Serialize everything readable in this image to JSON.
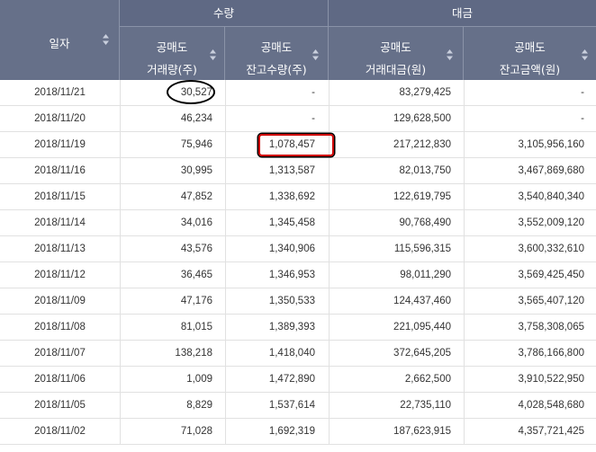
{
  "header": {
    "date_label": "일자",
    "group_quantity": "수량",
    "group_amount": "대금",
    "columns": [
      {
        "line1": "공매도",
        "line2": "거래량(주)"
      },
      {
        "line1": "공매도",
        "line2": "잔고수량(주)"
      },
      {
        "line1": "공매도",
        "line2": "거래대금(원)"
      },
      {
        "line1": "공매도",
        "line2": "잔고금액(원)"
      }
    ]
  },
  "rows": [
    [
      "2018/11/21",
      "30,527",
      "-",
      "83,279,425",
      "-"
    ],
    [
      "2018/11/20",
      "46,234",
      "-",
      "129,628,500",
      "-"
    ],
    [
      "2018/11/19",
      "75,946",
      "1,078,457",
      "217,212,830",
      "3,105,956,160"
    ],
    [
      "2018/11/16",
      "30,995",
      "1,313,587",
      "82,013,750",
      "3,467,869,680"
    ],
    [
      "2018/11/15",
      "47,852",
      "1,338,692",
      "122,619,795",
      "3,540,840,340"
    ],
    [
      "2018/11/14",
      "34,016",
      "1,345,458",
      "90,768,490",
      "3,552,009,120"
    ],
    [
      "2018/11/13",
      "43,576",
      "1,340,906",
      "115,596,315",
      "3,600,332,610"
    ],
    [
      "2018/11/12",
      "36,465",
      "1,346,953",
      "98,011,290",
      "3,569,425,450"
    ],
    [
      "2018/11/09",
      "47,176",
      "1,350,533",
      "124,437,460",
      "3,565,407,120"
    ],
    [
      "2018/11/08",
      "81,015",
      "1,389,393",
      "221,095,440",
      "3,758,308,065"
    ],
    [
      "2018/11/07",
      "138,218",
      "1,418,040",
      "372,645,205",
      "3,786,166,800"
    ],
    [
      "2018/11/06",
      "1,009",
      "1,472,890",
      "2,662,500",
      "3,910,522,950"
    ],
    [
      "2018/11/05",
      "8,829",
      "1,537,614",
      "22,735,110",
      "4,028,548,680"
    ],
    [
      "2018/11/02",
      "71,028",
      "1,692,319",
      "187,623,915",
      "4,357,721,425"
    ]
  ],
  "colors": {
    "header_bg": "#667089",
    "ellipse_marker": "#000000",
    "rect_marker": "#d00000"
  },
  "icons": {
    "sort": "sort-arrows-icon"
  }
}
